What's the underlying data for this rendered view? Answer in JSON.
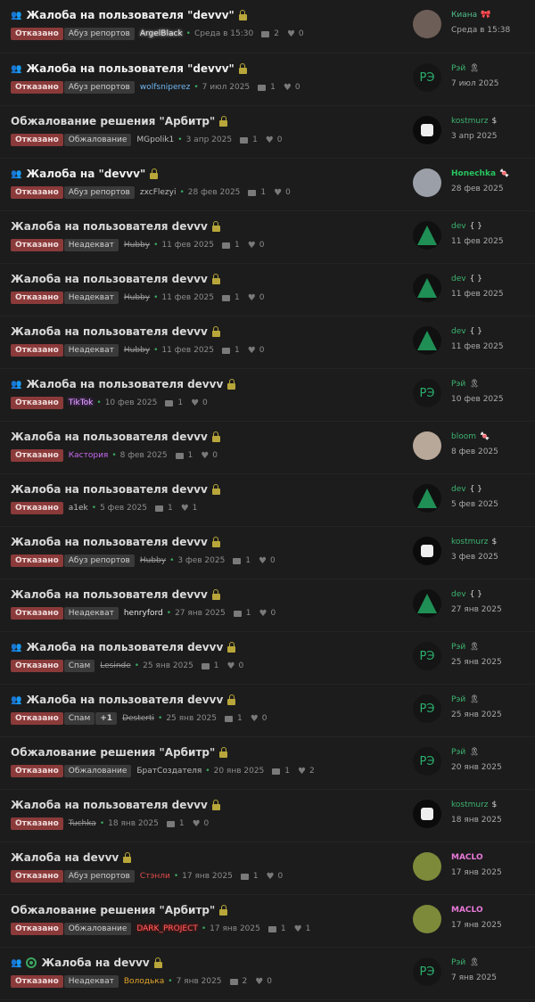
{
  "threads": [
    {
      "title": "Жалоба на пользователя \"devvv\"",
      "unread": true,
      "icon": "group-icon",
      "status": "Отказано",
      "category": "Абуз репортов",
      "author": "ArgelBlack",
      "author_style": "a-angel",
      "date": "Среда в 15:30",
      "replies": "2",
      "likes": "0",
      "last_user": "Киана",
      "last_user_style": "n-kiana",
      "last_badge": "🎀",
      "last_date": "Среда в 15:38",
      "avatar": "photo",
      "avatar_text": ""
    },
    {
      "title": "Жалоба на пользователя \"devvv\"",
      "unread": true,
      "icon": "group-icon",
      "status": "Отказано",
      "category": "Абуз репортов",
      "author": "wolfsniperez",
      "author_style": "a-blue",
      "date": "7 июл 2025",
      "replies": "1",
      "likes": "0",
      "last_user": "Рэй",
      "last_user_style": "n-green",
      "last_badge": "🎗",
      "last_date": "7 июл 2025",
      "avatar": "re",
      "avatar_text": "РЭ"
    },
    {
      "title": "Обжалование решения \"Арбитр\"",
      "unread": false,
      "icon": "",
      "status": "Отказано",
      "category": "Обжалование",
      "author": "MGpolik1",
      "author_style": "",
      "date": "3 апр 2025",
      "replies": "1",
      "likes": "0",
      "last_user": "kostmurz",
      "last_user_style": "n-green",
      "last_badge": "$",
      "last_date": "3 апр 2025",
      "avatar": "ks",
      "avatar_text": ""
    },
    {
      "title": "Жалоба на \"devvv\"",
      "unread": true,
      "icon": "group-icon",
      "status": "Отказано",
      "category": "Абуз репортов",
      "author": "zxcFlezyi",
      "author_style": "",
      "date": "28 фев 2025",
      "replies": "1",
      "likes": "0",
      "last_user": "Honechka",
      "last_user_style": "n-bold",
      "last_badge": "🍬",
      "last_date": "28 фев 2025",
      "avatar": "cat",
      "avatar_text": ""
    },
    {
      "title": "Жалоба на пользователя devvv",
      "unread": false,
      "icon": "",
      "status": "Отказано",
      "category": "Неадекват",
      "author": "Hubby",
      "author_style": "a-strike",
      "date": "11 фев 2025",
      "replies": "1",
      "likes": "0",
      "last_user": "dev",
      "last_user_style": "n-green",
      "last_badge": "{ }",
      "last_date": "11 фев 2025",
      "avatar": "wolf",
      "avatar_text": ""
    },
    {
      "title": "Жалоба на пользователя devvv",
      "unread": false,
      "icon": "",
      "status": "Отказано",
      "category": "Неадекват",
      "author": "Hubby",
      "author_style": "a-strike",
      "date": "11 фев 2025",
      "replies": "1",
      "likes": "0",
      "last_user": "dev",
      "last_user_style": "n-green",
      "last_badge": "{ }",
      "last_date": "11 фев 2025",
      "avatar": "wolf",
      "avatar_text": ""
    },
    {
      "title": "Жалоба на пользователя devvv",
      "unread": false,
      "icon": "",
      "status": "Отказано",
      "category": "Неадекват",
      "author": "Hubby",
      "author_style": "a-strike",
      "date": "11 фев 2025",
      "replies": "1",
      "likes": "0",
      "last_user": "dev",
      "last_user_style": "n-green",
      "last_badge": "{ }",
      "last_date": "11 фев 2025",
      "avatar": "wolf",
      "avatar_text": ""
    },
    {
      "title": "Жалоба на пользователя devvv",
      "unread": false,
      "icon": "group-icon",
      "status": "Отказано",
      "category": "",
      "author": "TikTok",
      "author_style": "a-tiktok",
      "date": "10 фев 2025",
      "replies": "1",
      "likes": "0",
      "last_user": "Рэй",
      "last_user_style": "n-green",
      "last_badge": "🎗",
      "last_date": "10 фев 2025",
      "avatar": "re",
      "avatar_text": "РЭ"
    },
    {
      "title": "Жалоба на пользователя devvv",
      "unread": false,
      "icon": "",
      "status": "Отказано",
      "category": "",
      "author": "Кастория",
      "author_style": "a-purple",
      "date": "8 фев 2025",
      "replies": "1",
      "likes": "0",
      "last_user": "bloom",
      "last_user_style": "n-green",
      "last_badge": "🍬",
      "last_date": "8 фев 2025",
      "avatar": "kitten",
      "avatar_text": ""
    },
    {
      "title": "Жалоба на пользователя devvv",
      "unread": false,
      "icon": "",
      "status": "Отказано",
      "category": "",
      "author": "a1ek",
      "author_style": "",
      "date": "5 фев 2025",
      "replies": "1",
      "likes": "1",
      "last_user": "dev",
      "last_user_style": "n-green",
      "last_badge": "{ }",
      "last_date": "5 фев 2025",
      "avatar": "wolf",
      "avatar_text": ""
    },
    {
      "title": "Жалоба на пользователя devvv",
      "unread": false,
      "icon": "",
      "status": "Отказано",
      "category": "Абуз репортов",
      "author": "Hubby",
      "author_style": "a-strike",
      "date": "3 фев 2025",
      "replies": "1",
      "likes": "0",
      "last_user": "kostmurz",
      "last_user_style": "n-green",
      "last_badge": "$",
      "last_date": "3 фев 2025",
      "avatar": "ks",
      "avatar_text": ""
    },
    {
      "title": "Жалоба на пользователя devvv",
      "unread": false,
      "icon": "",
      "status": "Отказано",
      "category": "Неадекват",
      "author": "henryford",
      "author_style": "a-white",
      "date": "27 янв 2025",
      "replies": "1",
      "likes": "0",
      "last_user": "dev",
      "last_user_style": "n-green",
      "last_badge": "{ }",
      "last_date": "27 янв 2025",
      "avatar": "wolf",
      "avatar_text": ""
    },
    {
      "title": "Жалоба на пользователя devvv",
      "unread": false,
      "icon": "group-icon",
      "status": "Отказано",
      "category": "Спам",
      "author": "Lesinde",
      "author_style": "a-strike",
      "date": "25 янв 2025",
      "replies": "1",
      "likes": "0",
      "last_user": "Рэй",
      "last_user_style": "n-green",
      "last_badge": "🎗",
      "last_date": "25 янв 2025",
      "avatar": "re",
      "avatar_text": "РЭ"
    },
    {
      "title": "Жалоба на пользователя devvv",
      "unread": false,
      "icon": "group-icon",
      "status": "Отказано",
      "category": "Спам",
      "extra": "+1",
      "author": "Desterti",
      "author_style": "a-strike",
      "date": "25 янв 2025",
      "replies": "1",
      "likes": "0",
      "last_user": "Рэй",
      "last_user_style": "n-green",
      "last_badge": "🎗",
      "last_date": "25 янв 2025",
      "avatar": "re",
      "avatar_text": "РЭ"
    },
    {
      "title": "Обжалование решения \"Арбитр\"",
      "unread": false,
      "icon": "",
      "status": "Отказано",
      "category": "Обжалование",
      "author": "БратСоздателя",
      "author_style": "",
      "date": "20 янв 2025",
      "replies": "1",
      "likes": "2",
      "last_user": "Рэй",
      "last_user_style": "n-green",
      "last_badge": "🎗",
      "last_date": "20 янв 2025",
      "avatar": "re",
      "avatar_text": "РЭ"
    },
    {
      "title": "Жалоба на пользователя devvv",
      "unread": false,
      "icon": "",
      "status": "Отказано",
      "category": "",
      "author": "Tuchka",
      "author_style": "a-strike",
      "date": "18 янв 2025",
      "replies": "1",
      "likes": "0",
      "last_user": "kostmurz",
      "last_user_style": "n-green",
      "last_badge": "$",
      "last_date": "18 янв 2025",
      "avatar": "ks",
      "avatar_text": ""
    },
    {
      "title": "Жалоба на devvv",
      "unread": false,
      "icon": "",
      "status": "Отказано",
      "category": "Абуз репортов",
      "author": "Стэнли",
      "author_style": "a-red",
      "date": "17 янв 2025",
      "replies": "1",
      "likes": "0",
      "last_user": "MACLO",
      "last_user_style": "n-pink",
      "last_badge": "",
      "last_date": "17 янв 2025",
      "avatar": "maclo",
      "avatar_text": ""
    },
    {
      "title": "Обжалование решения \"Арбитр\"",
      "unread": false,
      "icon": "",
      "status": "Отказано",
      "category": "Обжалование",
      "author": "DARK_PROJECT",
      "author_style": "a-dark",
      "date": "17 янв 2025",
      "replies": "1",
      "likes": "1",
      "last_user": "MACLO",
      "last_user_style": "n-pink",
      "last_badge": "",
      "last_date": "17 янв 2025",
      "avatar": "maclo",
      "avatar_text": ""
    },
    {
      "title": "Жалоба на devvv",
      "unread": false,
      "icon": "group-icon",
      "target": true,
      "status": "Отказано",
      "category": "Неадекват",
      "author": "Володька",
      "author_style": "a-gold",
      "date": "7 янв 2025",
      "replies": "2",
      "likes": "0",
      "last_user": "Рэй",
      "last_user_style": "n-green",
      "last_badge": "🎗",
      "last_date": "7 янв 2025",
      "avatar": "re",
      "avatar_text": "РЭ"
    }
  ]
}
